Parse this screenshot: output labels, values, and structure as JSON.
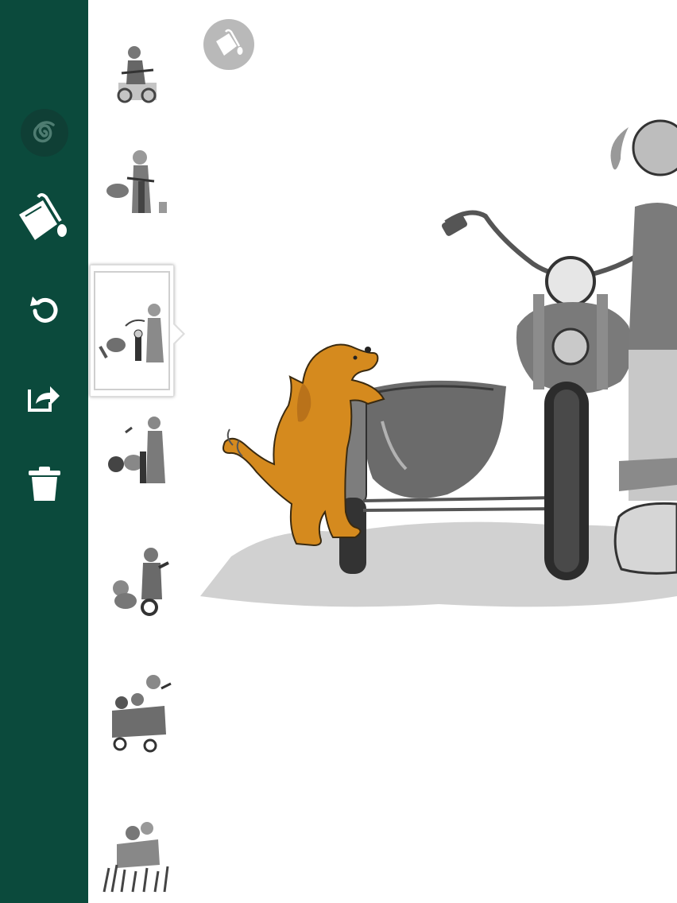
{
  "sidebar": {
    "background": "#0b4a3c",
    "tools": [
      {
        "name": "spiral-logo-icon"
      },
      {
        "name": "paint-bucket-icon"
      },
      {
        "name": "undo-icon"
      },
      {
        "name": "share-icon"
      },
      {
        "name": "trash-icon"
      }
    ]
  },
  "thumbnails": {
    "count": 7,
    "selected_index": 2
  },
  "canvas": {
    "fill_color": "#d58a1e"
  },
  "fab": {
    "icon": "paint-bucket-icon",
    "color": "#b9b9b9"
  }
}
